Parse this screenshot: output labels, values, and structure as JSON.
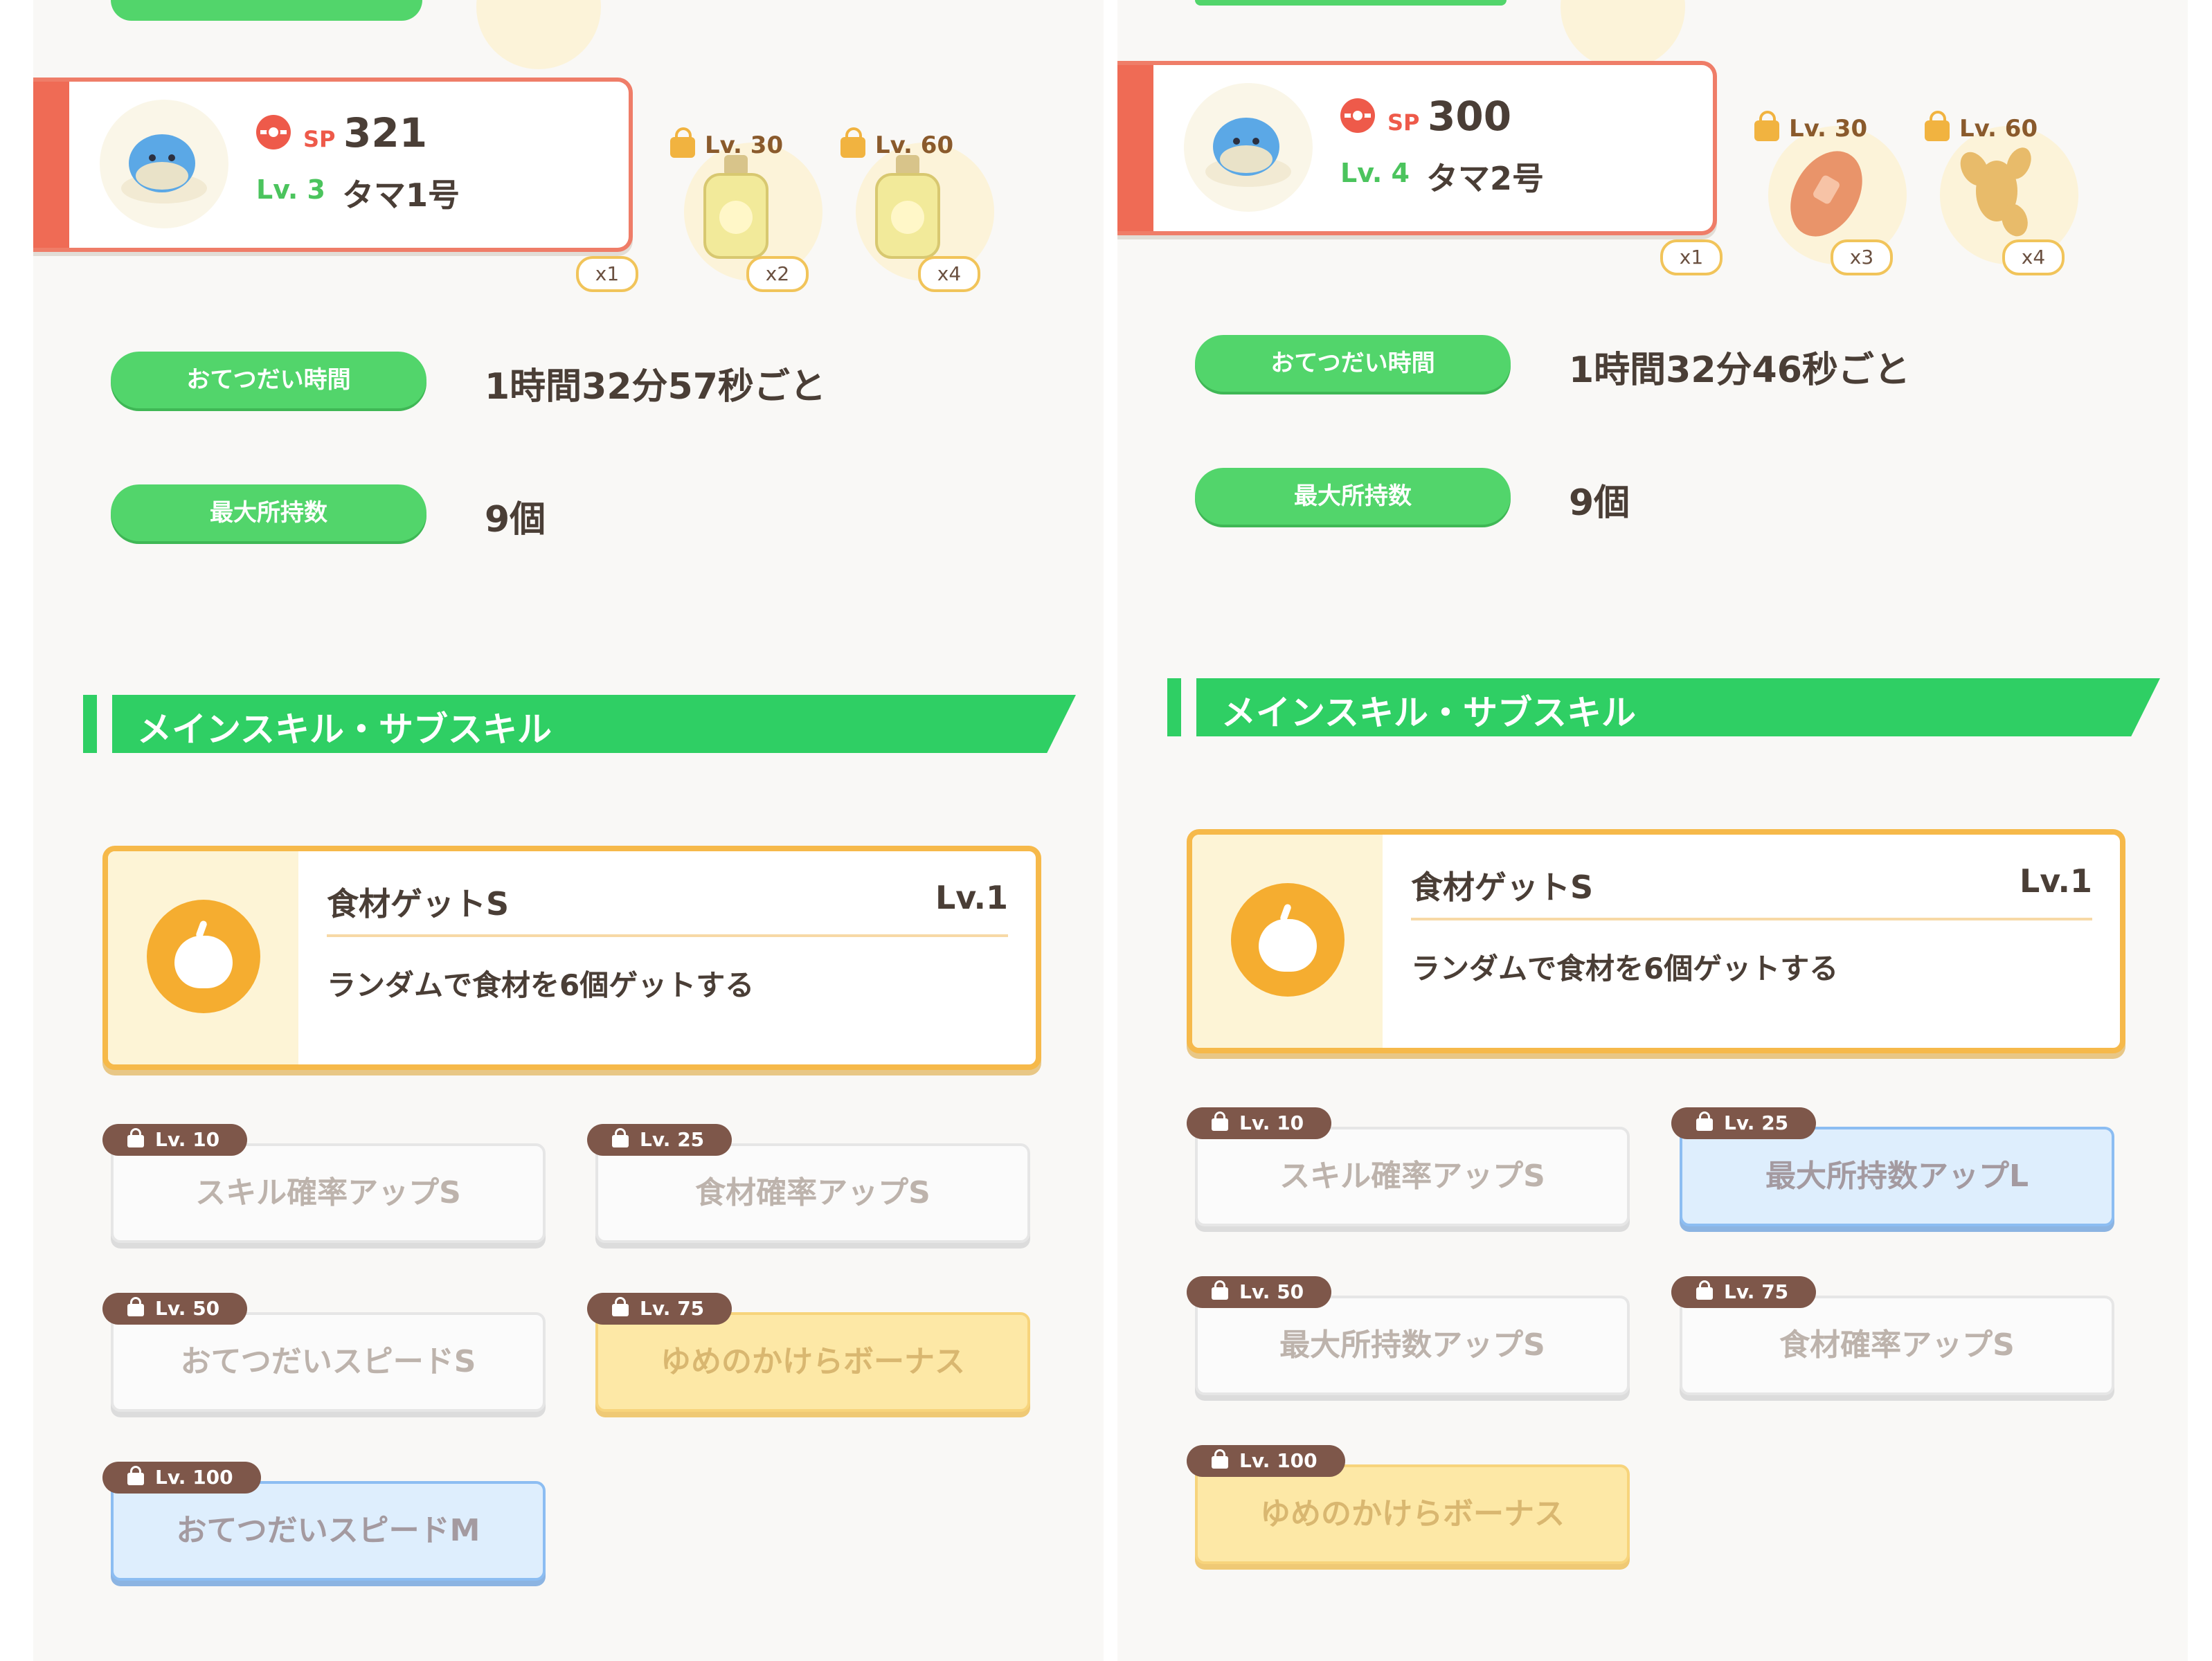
{
  "panels": [
    {
      "sp_label": "SP",
      "sp_value": "321",
      "level": "Lv. 3",
      "name": "タマ1号",
      "ingredients": [
        {
          "icon": "ingredient-icon",
          "lock_level": "",
          "qty": "x1"
        },
        {
          "icon": "oil-bottle-icon",
          "lock_level": "Lv. 30",
          "qty": "x2"
        },
        {
          "icon": "oil-bottle-icon",
          "lock_level": "Lv. 60",
          "qty": "x4"
        }
      ],
      "help_time_label": "おてつだい時間",
      "help_time_value": "1時間32分57秒ごと",
      "max_carry_label": "最大所持数",
      "max_carry_value": "9個",
      "section_title": "メインスキル・サブスキル",
      "main_skill": {
        "name": "食材ゲットS",
        "level": "Lv.1",
        "description": "ランダムで食材を6個ゲットする"
      },
      "sub_skills": [
        {
          "unlock": "Lv. 10",
          "name": "スキル確率アップS",
          "style": "white"
        },
        {
          "unlock": "Lv. 25",
          "name": "食材確率アップS",
          "style": "white"
        },
        {
          "unlock": "Lv. 50",
          "name": "おてつだいスピードS",
          "style": "white"
        },
        {
          "unlock": "Lv. 75",
          "name": "ゆめのかけらボーナス",
          "style": "gold"
        },
        {
          "unlock": "Lv. 100",
          "name": "おてつだいスピードM",
          "style": "blue"
        }
      ]
    },
    {
      "sp_label": "SP",
      "sp_value": "300",
      "level": "Lv. 4",
      "name": "タマ2号",
      "ingredients": [
        {
          "icon": "ingredient-icon",
          "lock_level": "",
          "qty": "x1"
        },
        {
          "icon": "potato-icon",
          "lock_level": "Lv. 30",
          "qty": "x3"
        },
        {
          "icon": "ginger-icon",
          "lock_level": "Lv. 60",
          "qty": "x4"
        }
      ],
      "help_time_label": "おてつだい時間",
      "help_time_value": "1時間32分46秒ごと",
      "max_carry_label": "最大所持数",
      "max_carry_value": "9個",
      "section_title": "メインスキル・サブスキル",
      "main_skill": {
        "name": "食材ゲットS",
        "level": "Lv.1",
        "description": "ランダムで食材を6個ゲットする"
      },
      "sub_skills": [
        {
          "unlock": "Lv. 10",
          "name": "スキル確率アップS",
          "style": "white"
        },
        {
          "unlock": "Lv. 25",
          "name": "最大所持数アップL",
          "style": "blue"
        },
        {
          "unlock": "Lv. 50",
          "name": "最大所持数アップS",
          "style": "white"
        },
        {
          "unlock": "Lv. 75",
          "name": "食材確率アップS",
          "style": "white"
        },
        {
          "unlock": "Lv. 100",
          "name": "ゆめのかけらボーナス",
          "style": "gold"
        }
      ]
    }
  ],
  "colors": {
    "green": "#52d56b",
    "coral": "#ef6b55",
    "gold": "#f6b94a",
    "blue": "#8cbdf2"
  }
}
